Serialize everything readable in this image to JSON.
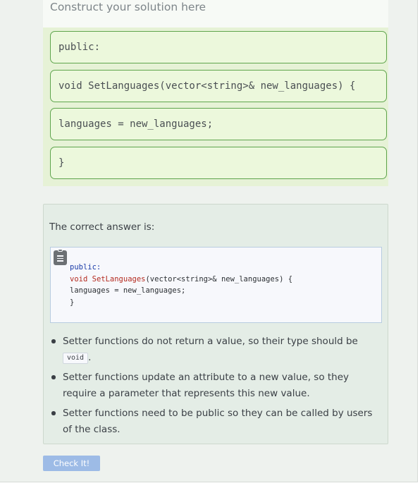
{
  "solution": {
    "header": "Construct your solution here",
    "blocks": [
      "public:",
      "void SetLanguages(vector<string>& new_languages) {",
      "languages = new_languages;",
      "}"
    ]
  },
  "feedback": {
    "title": "The correct answer is:",
    "code": {
      "line1": "public:",
      "line2_kw": "void",
      "line2_fn": "SetLanguages",
      "line2_rest": "(vector<string>& new_languages) {",
      "line3": "languages = new_languages;",
      "line4": "}"
    },
    "bullets": {
      "b1_text": "Setter functions do not return a value, so their type should be",
      "b1_code": "void",
      "b1_end": ".",
      "b2": "Setter functions update an attribute to a new value, so they require a parameter that represents this new value.",
      "b3": "Setter functions need to be public so they can be called by users of the class."
    }
  },
  "actions": {
    "check_label": "Check It!"
  },
  "colors": {
    "block_border": "#5fa54d",
    "block_bg": "#ecf8dc",
    "check_button": "#9dbbe6"
  }
}
